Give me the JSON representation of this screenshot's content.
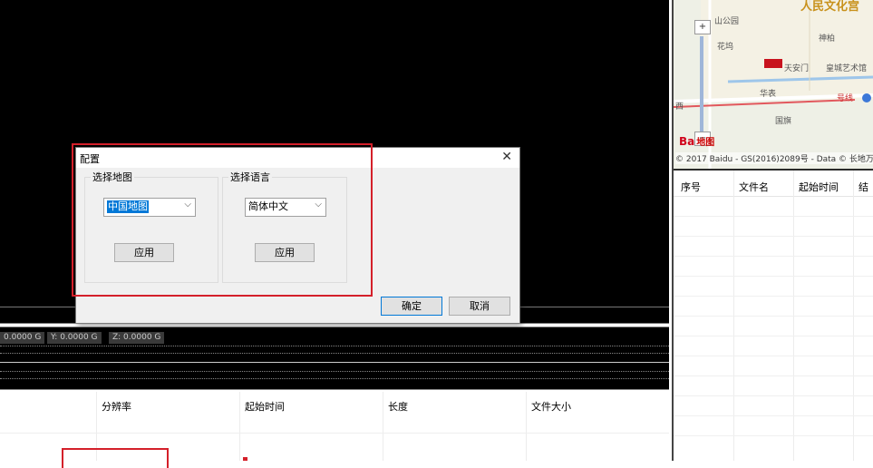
{
  "sensor": {
    "x_label": "0.0000 G",
    "y_label": "Y: 0.0000 G",
    "z_label": "Z: 0.0000 G"
  },
  "map": {
    "title": "人民文化宫",
    "labels": [
      "山公园",
      "花坞",
      "神柏",
      "天安门",
      "皇城艺术馆",
      "华表",
      "号线",
      "国旗",
      "西"
    ],
    "logo_text": "Ba",
    "logo_suffix": "地图",
    "copyright": "© 2017 Baidu - GS(2016)2089号 - Data © 长地万"
  },
  "right_table": {
    "columns": [
      "序号",
      "文件名",
      "起始时间",
      "结"
    ]
  },
  "bottom_table": {
    "columns": [
      "分辨率",
      "起始时间",
      "长度",
      "文件大小"
    ]
  },
  "dialog": {
    "title": "配置",
    "close_glyph": "✕",
    "map_group": {
      "label": "选择地图",
      "selected": "中国地图",
      "apply": "应用"
    },
    "language_group": {
      "label": "选择语言",
      "selected": "简体中文",
      "apply": "应用"
    },
    "ok": "确定",
    "cancel": "取消"
  },
  "colors": {
    "highlight_red": "#d4202a",
    "selection_blue": "#0078d7"
  }
}
